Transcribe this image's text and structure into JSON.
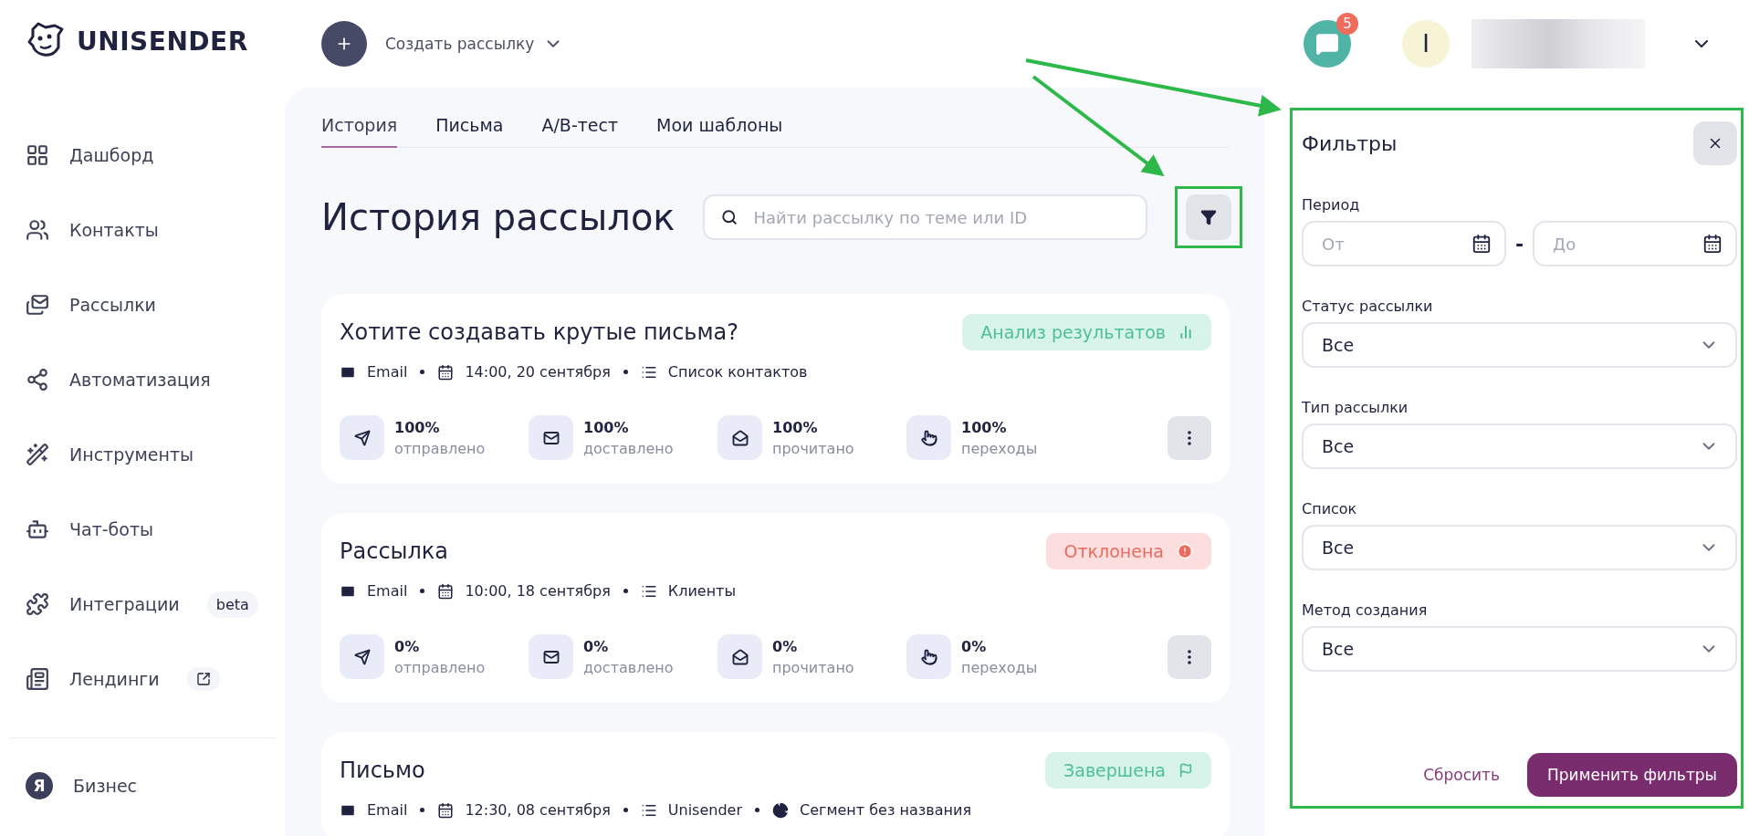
{
  "header": {
    "logo": "UNISENDER",
    "create_label": "Создать рассылку",
    "notifications": "5",
    "avatar": "I"
  },
  "sidebar": {
    "items": [
      {
        "label": "Дашборд"
      },
      {
        "label": "Контакты"
      },
      {
        "label": "Рассылки"
      },
      {
        "label": "Автоматизация"
      },
      {
        "label": "Инструменты"
      },
      {
        "label": "Чат-боты"
      },
      {
        "label": "Интеграции",
        "badge": "beta"
      },
      {
        "label": "Лендинги",
        "external": true
      }
    ],
    "footer_item": {
      "label": "Бизнес",
      "logo": "Я"
    }
  },
  "tabs": [
    {
      "label": "История",
      "selected": true
    },
    {
      "label": "Письма",
      "selected": false
    },
    {
      "label": "A/B-тест",
      "selected": false
    },
    {
      "label": "Мои шаблоны",
      "selected": false
    }
  ],
  "page_title": "История рассылок",
  "search": {
    "placeholder": "Найти рассылку по теме или ID"
  },
  "campaigns": [
    {
      "title": "Хотите создавать крутые письма?",
      "status": {
        "label": "Анализ результатов",
        "kind": "analysis"
      },
      "channel": "Email",
      "datetime": "14:00, 20 сентября",
      "list": "Список контактов",
      "stats": [
        {
          "value": "100%",
          "label": "отправлено"
        },
        {
          "value": "100%",
          "label": "доставлено"
        },
        {
          "value": "100%",
          "label": "прочитано"
        },
        {
          "value": "100%",
          "label": "переходы"
        }
      ]
    },
    {
      "title": "Рассылка",
      "status": {
        "label": "Отклонена",
        "kind": "rejected"
      },
      "channel": "Email",
      "datetime": "10:00, 18 сентября",
      "list": "Клиенты",
      "stats": [
        {
          "value": "0%",
          "label": "отправлено"
        },
        {
          "value": "0%",
          "label": "доставлено"
        },
        {
          "value": "0%",
          "label": "прочитано"
        },
        {
          "value": "0%",
          "label": "переходы"
        }
      ]
    },
    {
      "title": "Письмо",
      "status": {
        "label": "Завершена",
        "kind": "done"
      },
      "channel": "Email",
      "datetime": "12:30, 08 сентября",
      "list": "Unisender",
      "segment": "Сегмент без названия"
    }
  ],
  "filters": {
    "title": "Фильтры",
    "period_label": "Период",
    "from_placeholder": "От",
    "separator": "-",
    "to_placeholder": "До",
    "selects": [
      {
        "label": "Статус рассылки",
        "value": "Все"
      },
      {
        "label": "Тип рассылки",
        "value": "Все"
      },
      {
        "label": "Список",
        "value": "Все"
      },
      {
        "label": "Метод создания",
        "value": "Все"
      }
    ],
    "reset": "Сбросить",
    "apply": "Применить фильтры"
  }
}
